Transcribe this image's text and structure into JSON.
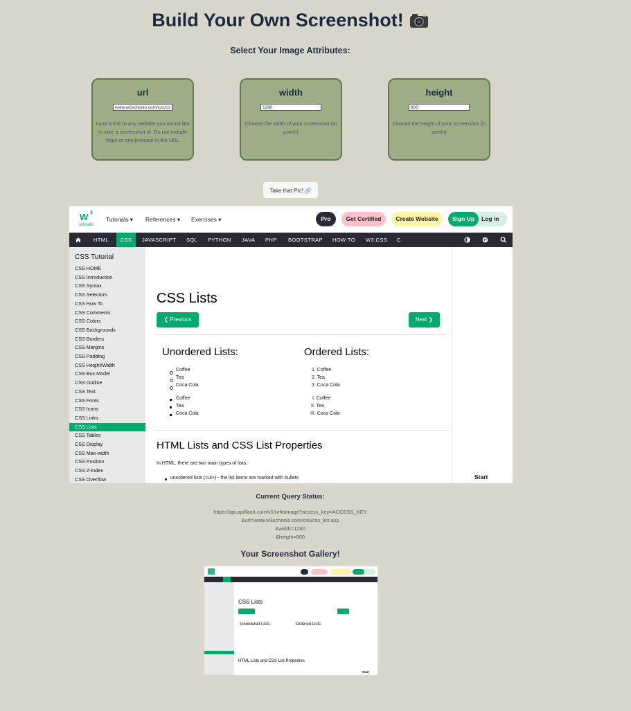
{
  "header": {
    "title": "Build Your Own Screenshot!",
    "subtitle": "Select Your Image Attributes:"
  },
  "cards": [
    {
      "label": "url",
      "value": "www.w3schools.com/css/css",
      "help": "Input a link to any website you would like to take a screenshot of. Do not include https or any protocol in the URL"
    },
    {
      "label": "width",
      "value": "1280",
      "help": "Choose the width of your screenshot (in pixels)"
    },
    {
      "label": "height",
      "value": "800",
      "help": "Choose the height of your screenshot (in pixels)"
    }
  ],
  "take_button": "Take that Pic! 🔗",
  "preview": {
    "logo_w": "W",
    "logo_sup": "3",
    "logo_sub": "schools",
    "menus": [
      "Tutorials ▾",
      "References ▾",
      "Exercises ▾"
    ],
    "pills": [
      "Pro",
      "Get Certified",
      "Create Website",
      "Sign Up",
      "Log in"
    ],
    "nav": [
      "HTML",
      "CSS",
      "JAVASCRIPT",
      "SQL",
      "PYTHON",
      "JAVA",
      "PHP",
      "BOOTSTRAP",
      "HOW TO",
      "W3.CSS",
      "C"
    ],
    "sidebar_title": "CSS Tutorial",
    "sidebar_items": [
      "CSS HOME",
      "CSS Introduction",
      "CSS Syntax",
      "CSS Selectors",
      "CSS How To",
      "CSS Comments",
      "CSS Colors",
      "CSS Backgrounds",
      "CSS Borders",
      "CSS Margins",
      "CSS Padding",
      "CSS Height/Width",
      "CSS Box Model",
      "CSS Outline",
      "CSS Text",
      "CSS Fonts",
      "CSS Icons",
      "CSS Links",
      "CSS Lists",
      "CSS Tables",
      "CSS Display",
      "CSS Max-width",
      "CSS Position",
      "CSS Z-index",
      "CSS Overflow"
    ],
    "page_title": "CSS Lists",
    "prev": "❮ Previous",
    "next": "Next ❯",
    "unordered_title": "Unordered Lists:",
    "ordered_title": "Ordered Lists:",
    "ul1": [
      "Coffee",
      "Tea",
      "Coca Cola"
    ],
    "ul2": [
      "Coffee",
      "Tea",
      "Coca Cola"
    ],
    "ol1": [
      "1. Coffee",
      "2. Tea",
      "3. Coca Cola"
    ],
    "ol2": [
      "I. Coffee",
      "II. Tea",
      "III. Coca Cola"
    ],
    "section_title": "HTML Lists and CSS List Properties",
    "section_text": "In HTML, there are two main types of lists:",
    "section_bullet": "unordered lists (<ul>) - the list items are marked with bullets",
    "right_label": "Start"
  },
  "query": {
    "title": "Current Query Status:",
    "lines": [
      "https://api.apiflash.com/v1/urltoimage?access_key=ACCESS_KEY",
      "&url=www.w3schools.com/css/css_list.asp",
      "&width=1280",
      "&height=800"
    ]
  },
  "gallery": {
    "title": "Your Screenshot Gallery!"
  },
  "colors": {
    "accent": "#04aa6d",
    "background": "#d9d6cb",
    "card": "#9fad86"
  }
}
